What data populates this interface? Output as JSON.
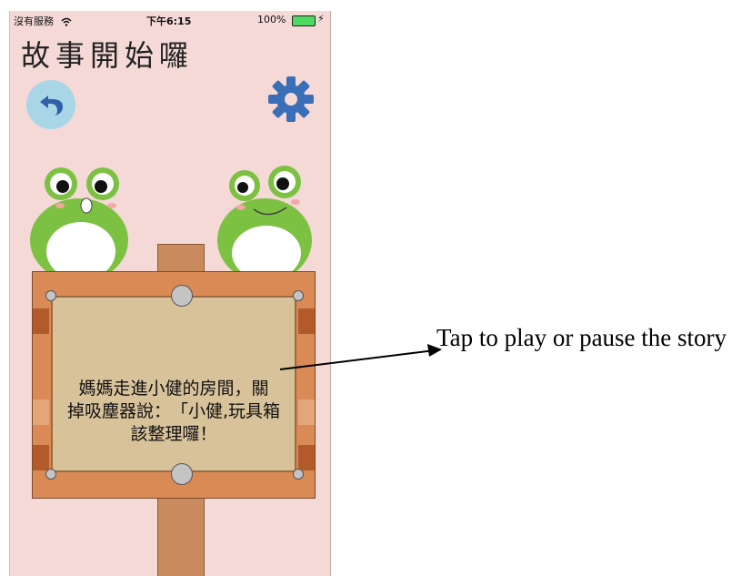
{
  "status_bar": {
    "carrier": "沒有服務",
    "time": "下午6:15",
    "battery_percent": "100%",
    "wifi_icon": "wifi-icon",
    "battery_icon": "battery-full-icon",
    "charge_icon": "lightning-icon"
  },
  "header": {
    "title": "故事開始囉"
  },
  "controls": {
    "back_icon": "back-arrow-icon",
    "settings_icon": "gear-icon"
  },
  "board": {
    "story_text_line1": "媽媽走進小健的房間，關",
    "story_text_line2": "掉吸塵器說：　「小健,玩具箱",
    "story_text_line3": "該整理囉！"
  },
  "annotation": {
    "text": "Tap to play or pause   the story"
  },
  "colors": {
    "background": "#f4d9d6",
    "board": "#d98a55",
    "board_panel": "#d7c29a",
    "frog_green": "#7cc142",
    "back_button": "#a9d6e6",
    "gear": "#3a6fb8"
  }
}
